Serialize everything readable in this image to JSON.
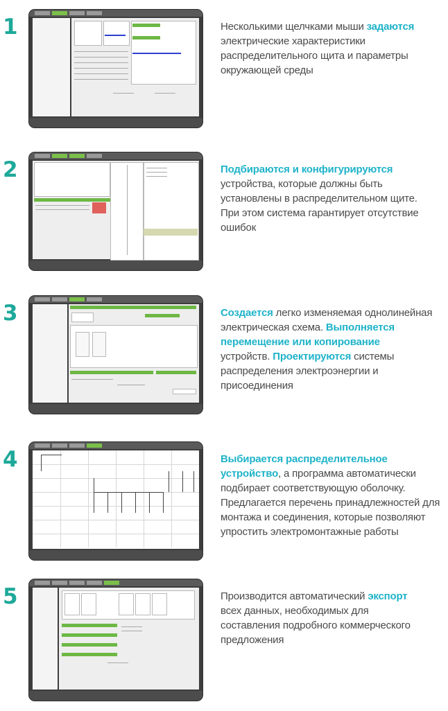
{
  "steps": [
    {
      "number": "1",
      "lines": [
        [
          {
            "t": "Несколькими щелчками мыши ",
            "hl": false
          },
          {
            "t": "задаются",
            "hl": true
          }
        ],
        [
          {
            "t": "электрические характеристики",
            "hl": false
          }
        ],
        [
          {
            "t": "распределительного щита и параметры",
            "hl": false
          }
        ],
        [
          {
            "t": "окружающей среды",
            "hl": false
          }
        ]
      ]
    },
    {
      "number": "2",
      "lines": [
        [
          {
            "t": "Подбираются и конфигурируются",
            "hl": true
          }
        ],
        [
          {
            "t": "устройства, которые должны быть",
            "hl": false
          }
        ],
        [
          {
            "t": "установлены в распределительном щите.",
            "hl": false
          }
        ],
        [
          {
            "t": "При этом система гарантирует отсутствие",
            "hl": false
          }
        ],
        [
          {
            "t": "ошибок",
            "hl": false
          }
        ]
      ]
    },
    {
      "number": "3",
      "lines": [
        [
          {
            "t": "Создается",
            "hl": true
          },
          {
            "t": " легко изменяемая однолинейная",
            "hl": false
          }
        ],
        [
          {
            "t": "электрическая схема. ",
            "hl": false
          },
          {
            "t": "Выполняется",
            "hl": true
          }
        ],
        [
          {
            "t": "перемещение или копирование",
            "hl": true
          }
        ],
        [
          {
            "t": "устройств. ",
            "hl": false
          },
          {
            "t": "Проектируются",
            "hl": true
          },
          {
            "t": " системы",
            "hl": false
          }
        ],
        [
          {
            "t": "распределения электроэнергии и",
            "hl": false
          }
        ],
        [
          {
            "t": "присоединения",
            "hl": false
          }
        ]
      ]
    },
    {
      "number": "4",
      "lines": [
        [
          {
            "t": "Выбирается распределительное",
            "hl": true
          }
        ],
        [
          {
            "t": "устройство",
            "hl": true
          },
          {
            "t": ", а программа автоматически",
            "hl": false
          }
        ],
        [
          {
            "t": "подбирает соответствующую оболочку.",
            "hl": false
          }
        ],
        [
          {
            "t": "Предлагается перечень принадлежностей для",
            "hl": false
          }
        ],
        [
          {
            "t": "монтажа и соединения, которые позволяют",
            "hl": false
          }
        ],
        [
          {
            "t": "упростить электромонтажные работы",
            "hl": false
          }
        ]
      ]
    },
    {
      "number": "5",
      "lines": [
        [
          {
            "t": "Производится автоматический ",
            "hl": false
          },
          {
            "t": "экспорт",
            "hl": true
          }
        ],
        [
          {
            "t": "всех данных, необходимых для",
            "hl": false
          }
        ],
        [
          {
            "t": "составления подробного коммерческого",
            "hl": false
          }
        ],
        [
          {
            "t": "предложения",
            "hl": false
          }
        ]
      ]
    }
  ],
  "colors": {
    "step_number": "#1ea99a",
    "highlight": "#1fb3c9",
    "body_text": "#4a4a4a",
    "screenshot_frame": "#3d3d3d",
    "active_tab": "#7bc04a"
  }
}
